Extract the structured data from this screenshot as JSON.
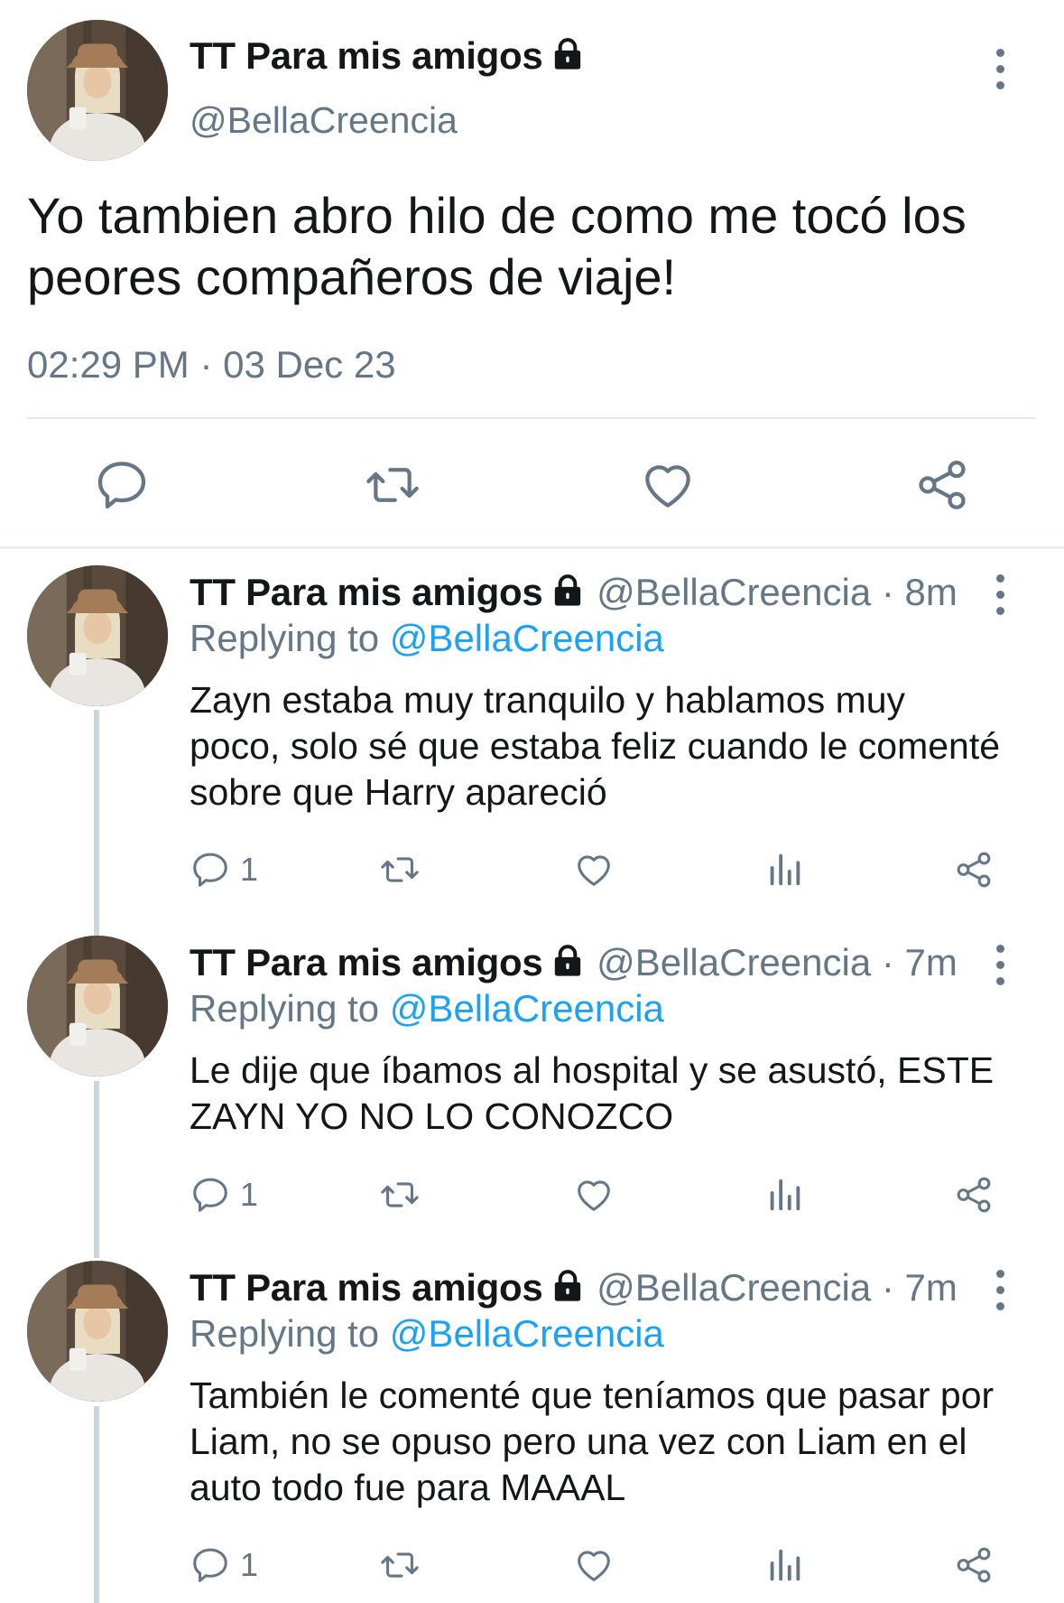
{
  "main_tweet": {
    "name": "TT Para mis amigos",
    "handle": "@BellaCreencia",
    "text": "Yo tambien abro hilo de como me tocó los peores compañeros de viaje!",
    "timestamp": "02:29 PM · 03 Dec 23",
    "actions": [
      "reply-icon",
      "retweet-icon",
      "like-icon",
      "share-icon"
    ]
  },
  "replies": [
    {
      "name": "TT Para mis amigos",
      "handle": "@BellaCreencia",
      "dot": "·",
      "time": "8m",
      "replying_prefix": "Replying to",
      "replying_to": "@BellaCreencia",
      "text": "Zayn estaba muy tranquilo y hablamos muy poco, solo sé que estaba feliz cuando le comenté sobre que Harry apareció",
      "reply_count": "1"
    },
    {
      "name": "TT Para mis amigos",
      "handle": "@BellaCreencia",
      "dot": "·",
      "time": "7m",
      "replying_prefix": "Replying to",
      "replying_to": "@BellaCreencia",
      "text": "Le dije que íbamos al hospital y se asustó, ESTE ZAYN YO NO LO CONOZCO",
      "reply_count": "1"
    },
    {
      "name": "TT Para mis amigos",
      "handle": "@BellaCreencia",
      "dot": "·",
      "time": "7m",
      "replying_prefix": "Replying to",
      "replying_to": "@BellaCreencia",
      "text": "También le comenté que teníamos que pasar por Liam, no se opuso pero una vez con Liam en el auto todo fue para MAAAL",
      "reply_count": "1"
    }
  ],
  "colors": {
    "text": "#14171a",
    "secondary": "#657786",
    "link": "#1da1f2",
    "divider": "#e1e8ed",
    "thread_line": "#ccd6dd"
  }
}
